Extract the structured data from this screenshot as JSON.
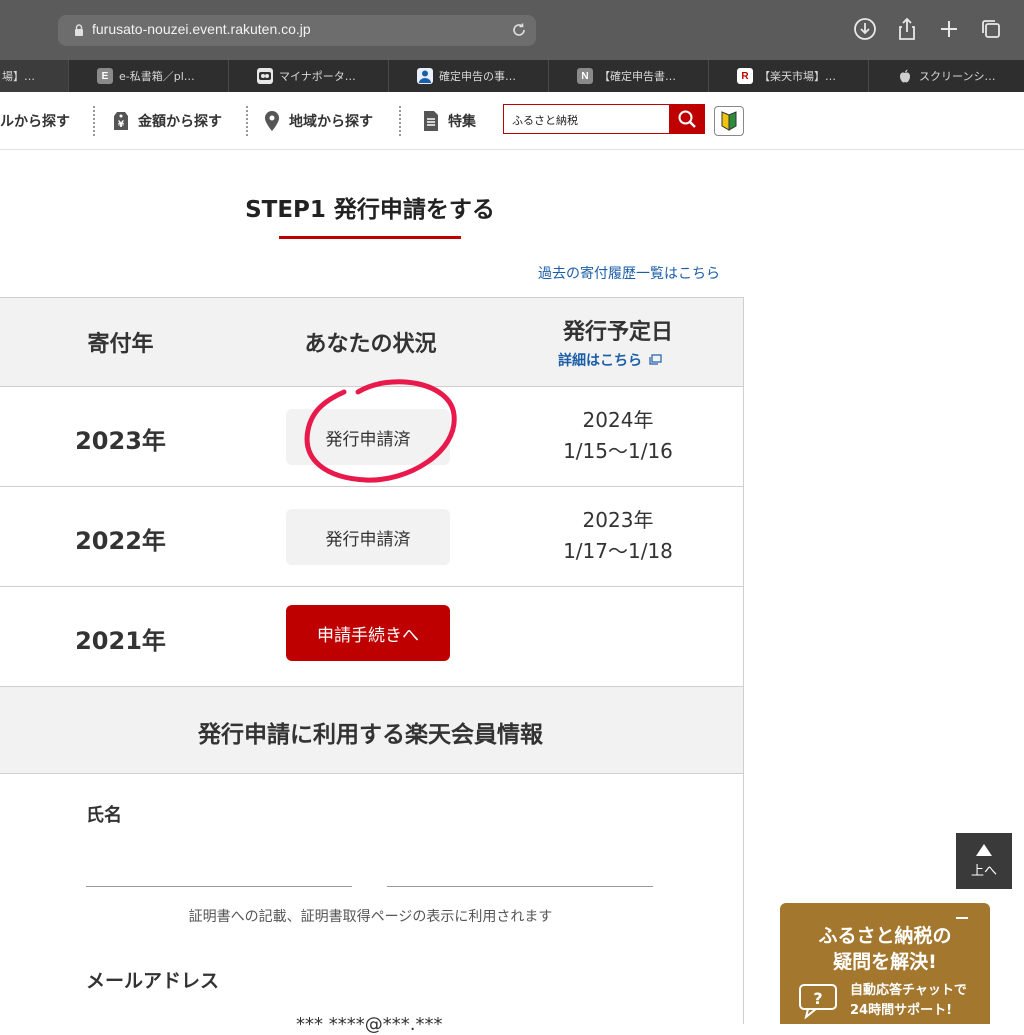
{
  "browser": {
    "url": "furusato-nouzei.event.rakuten.co.jp",
    "tabs": [
      {
        "label": "場】…",
        "fav": "",
        "fav_color": "#3c3c3c",
        "active": true
      },
      {
        "label": "e-私書箱／pl…",
        "fav": "E",
        "fav_color": "#8a8a8a",
        "active": false
      },
      {
        "label": "マイナポータ…",
        "fav": "",
        "fav_color": "#e8e8e8",
        "active": false
      },
      {
        "label": "確定申告の事…",
        "fav": "",
        "fav_color": "#e8f0ff",
        "active": false
      },
      {
        "label": "【確定申告書…",
        "fav": "N",
        "fav_color": "#8a8a8a",
        "active": false
      },
      {
        "label": "【楽天市場】…",
        "fav": "R",
        "fav_color": "#ffffff",
        "active": false
      },
      {
        "label": "スクリーンシ…",
        "fav": "",
        "fav_color": "#2e2e2e",
        "active": false
      }
    ]
  },
  "nav": {
    "genre": "ルから探す",
    "amount": "金額から探す",
    "region": "地域から探す",
    "feature": "特集",
    "search_value": "ふるさと納税"
  },
  "main": {
    "step_title": "STEP1 発行申請をする",
    "history_link": "過去の寄付履歴一覧はこちら",
    "headers": {
      "year": "寄付年",
      "status": "あなたの状況",
      "schedule": "発行予定日",
      "detail_link": "詳細はこちら"
    },
    "rows": [
      {
        "year": "2023年",
        "status": "発行申請済",
        "sched_year": "2024年",
        "sched_range": "1/15〜1/16"
      },
      {
        "year": "2022年",
        "status": "発行申請済",
        "sched_year": "2023年",
        "sched_range": "1/17〜1/18"
      },
      {
        "year": "2021年",
        "button": "申請手続きへ"
      }
    ]
  },
  "member": {
    "title": "発行申請に利用する楽天会員情報",
    "name_label": "氏名",
    "note": "証明書への記載、証明書取得ページの表示に利用されます",
    "mail_label": "メールアドレス",
    "mail_partial": "*** ****@***.***"
  },
  "floating": {
    "to_top": "上へ",
    "faq_title1": "ふるさと納税の",
    "faq_title2": "疑問を解決!",
    "faq_sub1": "自動応答チャットで",
    "faq_sub2": "24時間サポート!"
  },
  "colors": {
    "brand_red": "#bf0000",
    "link_blue": "#1b5ea8",
    "annotation_pink": "#e8194b",
    "faq_gold": "#a3772e"
  }
}
